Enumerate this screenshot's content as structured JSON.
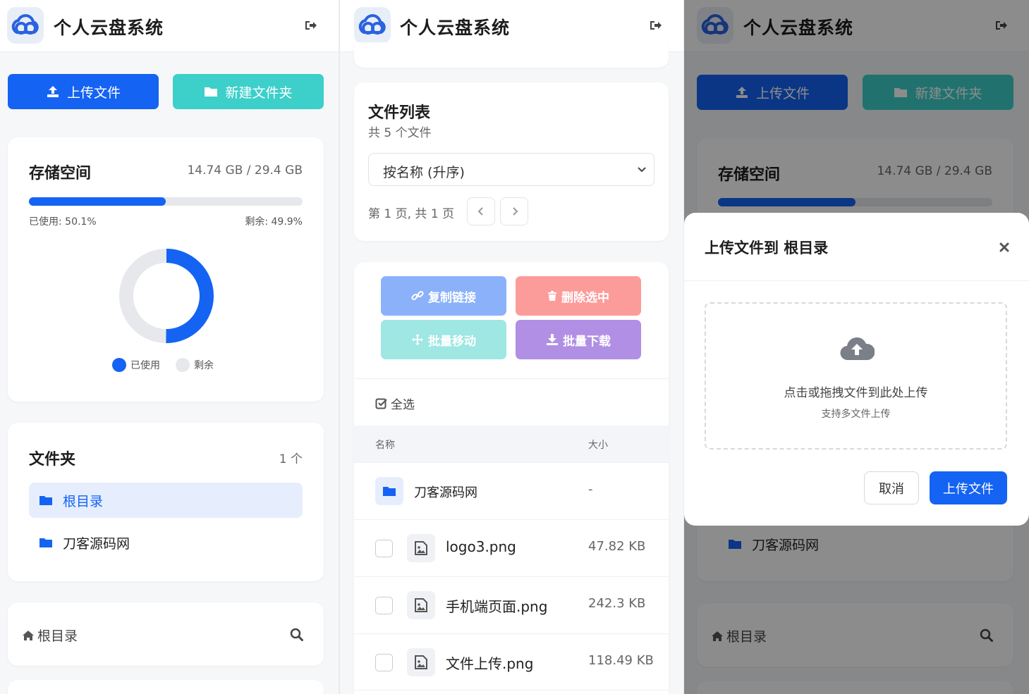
{
  "app": {
    "title": "个人云盘系统"
  },
  "toolbar": {
    "upload_label": "上传文件",
    "new_folder_label": "新建文件夹"
  },
  "storage": {
    "title": "存储空间",
    "usage_text": "14.74 GB / 29.4 GB",
    "used_text": "已使用: 50.1%",
    "remaining_text": "剩余: 49.9%",
    "used_percent": 50.1,
    "legend_used": "已使用",
    "legend_remaining": "剩余",
    "colors": {
      "used": "#1463f3",
      "remaining": "#e6e8ec"
    }
  },
  "folders": {
    "title": "文件夹",
    "count": "1 个",
    "items": [
      {
        "label": "根目录"
      },
      {
        "label": "刀客源码网"
      }
    ]
  },
  "breadcrumb": {
    "label": "根目录"
  },
  "file_list": {
    "title": "文件列表",
    "subtitle": "共 5 个文件",
    "sort_selected": "按名称 (升序)",
    "pagination_text": "第 1 页, 共 1 页",
    "actions": {
      "copy_link": "复制链接",
      "delete_selected": "删除选中",
      "batch_move": "批量移动",
      "batch_download": "批量下载"
    },
    "select_all": "全选",
    "columns": {
      "name": "名称",
      "size": "大小"
    },
    "rows": [
      {
        "name": "刀客源码网",
        "size": "-"
      },
      {
        "name": "logo3.png",
        "size": "47.82 KB"
      },
      {
        "name": "手机端页面.png",
        "size": "242.3 KB"
      },
      {
        "name": "文件上传.png",
        "size": "118.49 KB"
      }
    ]
  },
  "modal": {
    "title": "上传文件到 根目录",
    "drop_text": "点击或拖拽文件到此处上传",
    "drop_hint": "支持多文件上传",
    "cancel_label": "取消",
    "upload_label": "上传文件"
  }
}
